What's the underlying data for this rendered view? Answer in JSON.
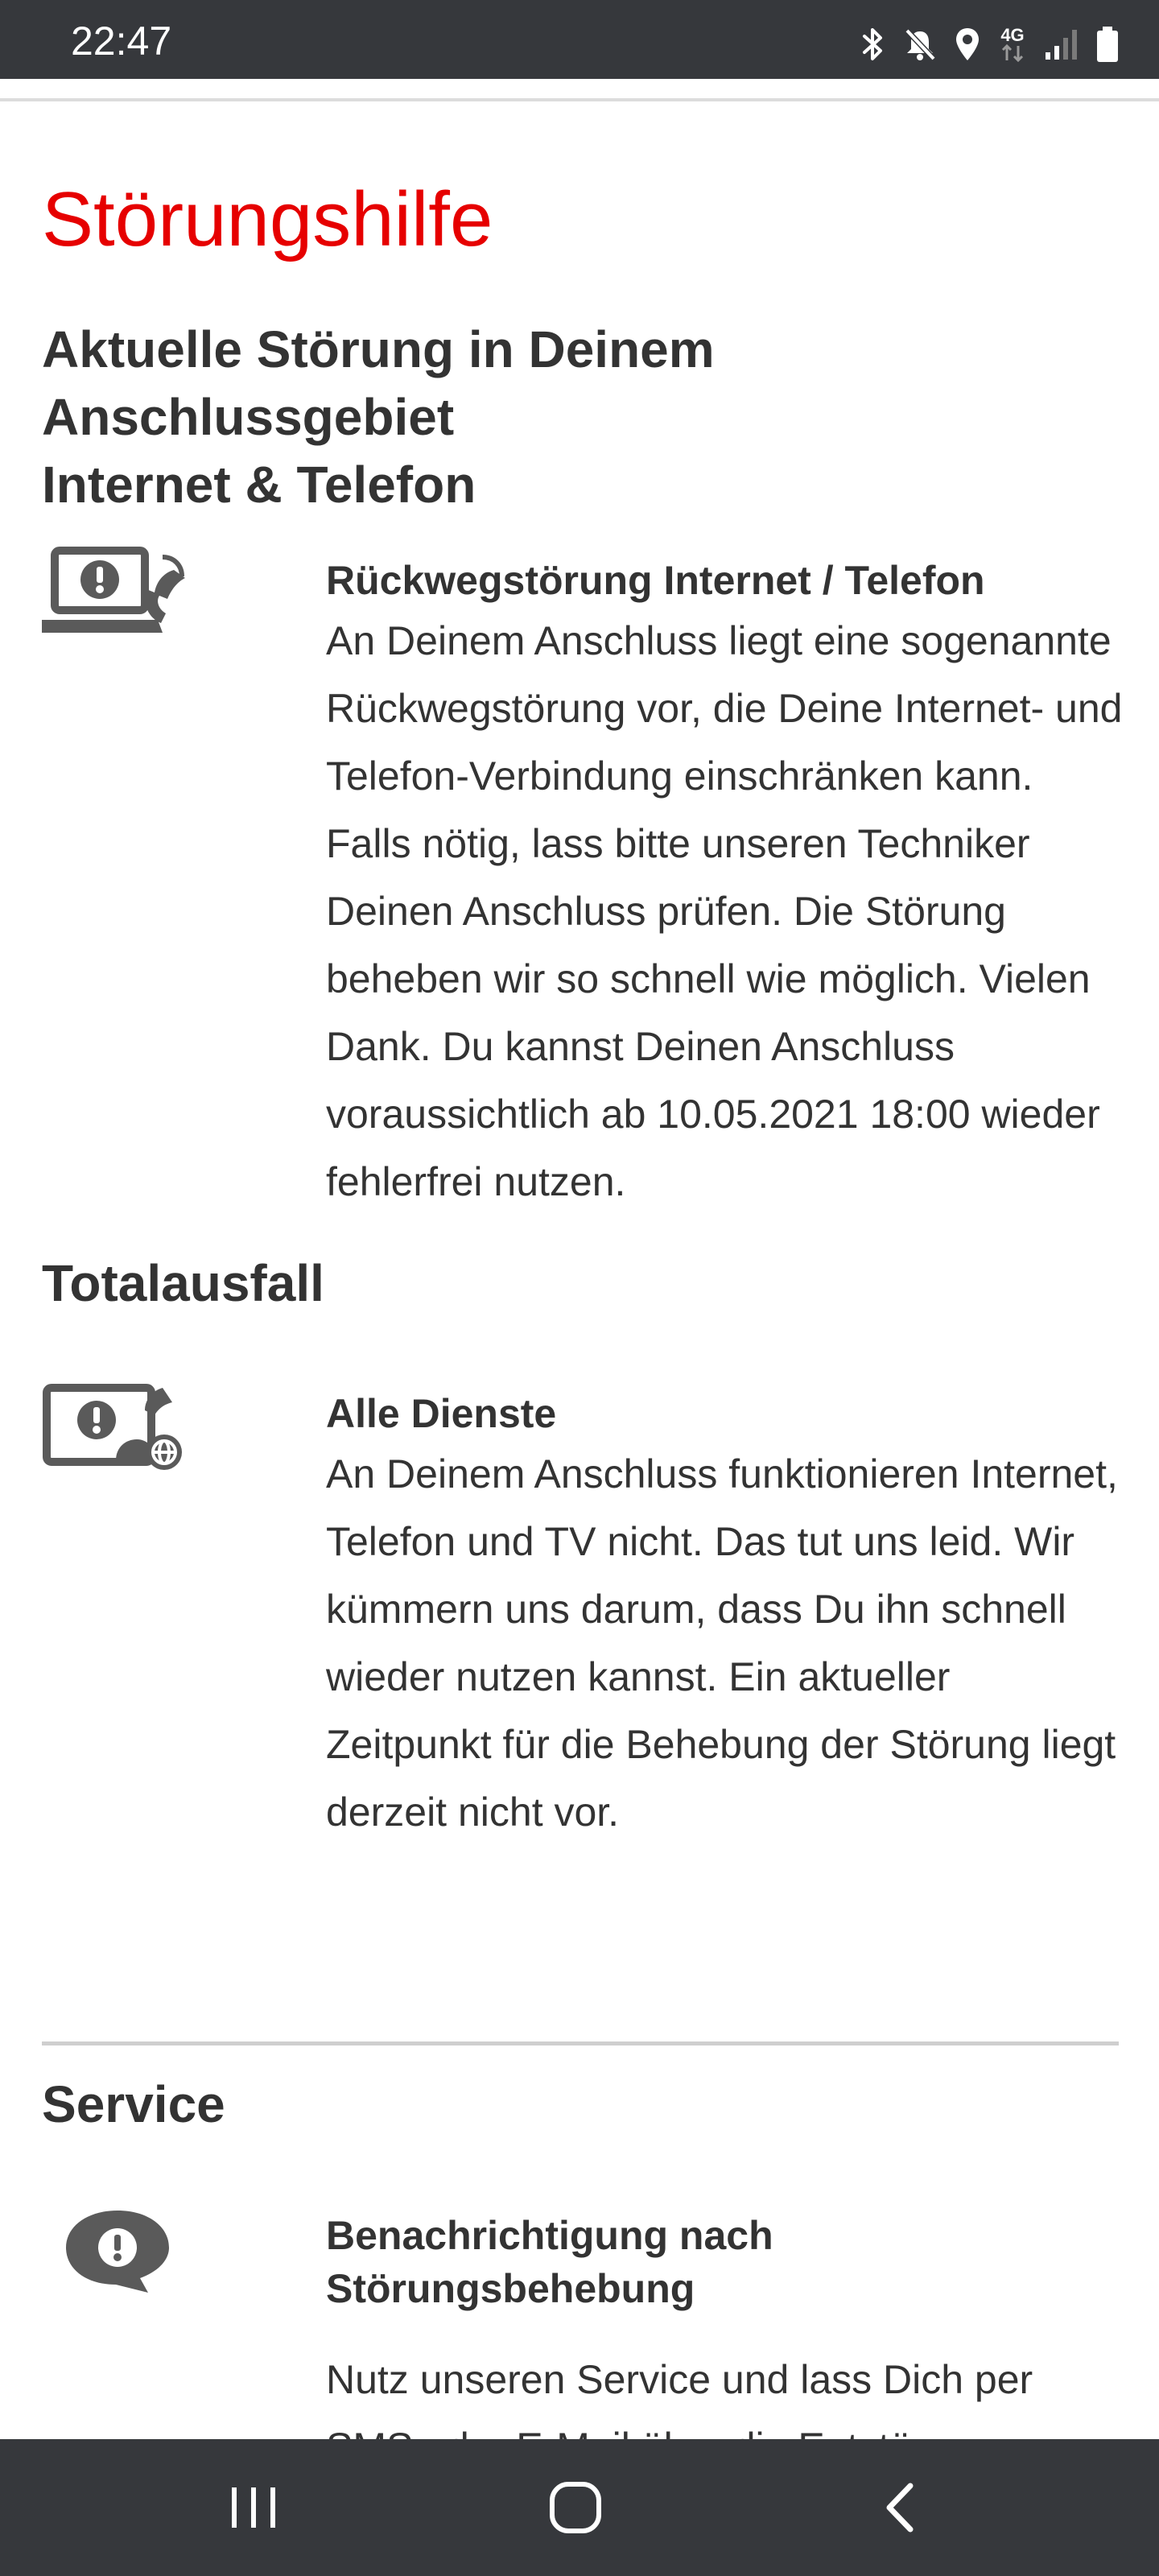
{
  "status_bar": {
    "time": "22:47",
    "network_type": "4G",
    "icons": [
      "bluetooth-icon",
      "mute-icon",
      "location-icon",
      "network-4g-icon",
      "signal-icon",
      "battery-icon"
    ]
  },
  "page": {
    "title": "Störungshilfe"
  },
  "current_outage": {
    "heading_lines": [
      "Aktuelle Störung in Deinem",
      "Anschlussgebiet",
      "Internet & Telefon"
    ],
    "entry": {
      "icon": "laptop-phone-warning-icon",
      "title": "Rückwegstörung Internet / Telefon",
      "body": "An Deinem Anschluss liegt eine sogenannte Rückwegstörung vor, die Deine Internet- und Telefon-Verbindung einschränken kann. Falls nötig, lass bitte unseren Techniker Deinen Anschluss prüfen. Die Störung beheben wir so schnell wie möglich. Vielen Dank. Du kannst Deinen Anschluss voraussichtlich ab 10.05.2021 18:00 wieder fehlerfrei nutzen."
    }
  },
  "total_outage": {
    "heading": "Totalausfall",
    "entry": {
      "icon": "tv-phone-globe-warning-icon",
      "title": "Alle Dienste",
      "body": "An Deinem Anschluss funktionieren Internet, Telefon und TV nicht. Das tut uns leid. Wir kümmern uns darum, dass Du ihn schnell wieder nutzen kannst. Ein aktueller Zeitpunkt für die Behebung der Störung liegt derzeit nicht vor."
    }
  },
  "service": {
    "heading": "Service",
    "entry": {
      "icon": "chat-warning-icon",
      "title": "Benachrichtigung nach Störungsbehebung",
      "body": "Nutz unseren Service und lass Dich per SMS oder E-Mail über die Entstörung informieren."
    }
  },
  "nav_bar": {
    "buttons": [
      "recent-apps-icon",
      "home-icon",
      "back-icon"
    ]
  },
  "colors": {
    "accent": "#e60000",
    "text": "#333333",
    "system_bar": "#36383c",
    "icon_gray": "#5a5a5a"
  }
}
